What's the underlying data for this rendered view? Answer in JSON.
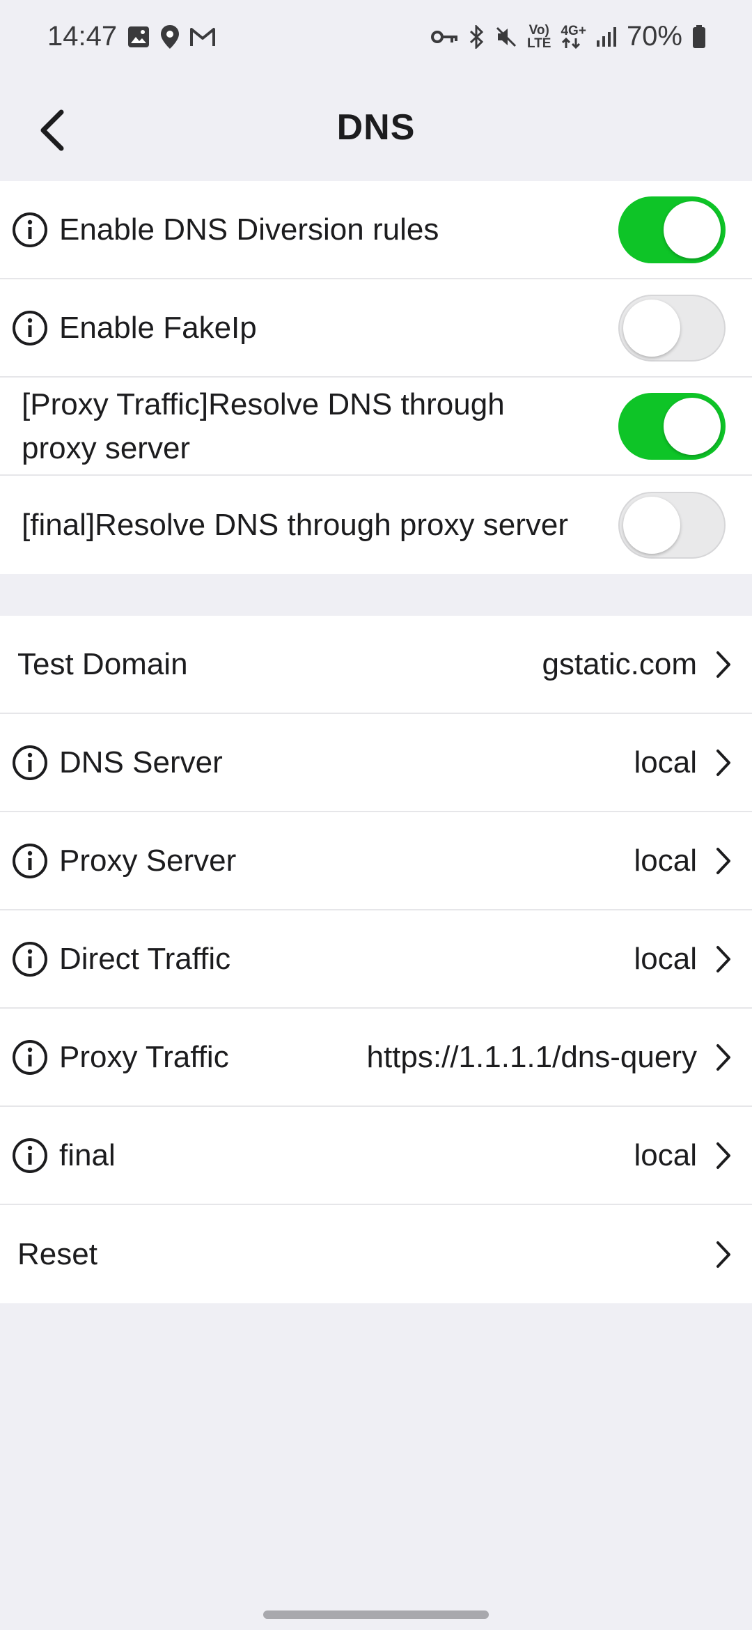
{
  "status_bar": {
    "time": "14:47",
    "left_icons": [
      "image-icon",
      "location-icon",
      "gmail-icon"
    ],
    "right_icons": [
      "vpn-key-icon",
      "bluetooth-icon",
      "mute-icon",
      "volte-icon",
      "4g-data-icon",
      "signal-icon"
    ],
    "volte_line1": "Vo)",
    "volte_line2": "LTE",
    "net_label": "4G+",
    "battery": "70%"
  },
  "header": {
    "title": "DNS",
    "back_icon": "chevron-left-icon"
  },
  "colors": {
    "toggle_on": "#0ec427",
    "toggle_off": "#e9e9ea",
    "background": "#efeff4"
  },
  "toggles": [
    {
      "label": "Enable DNS Diversion rules",
      "info_icon": true,
      "on": true
    },
    {
      "label": "Enable FakeIp",
      "info_icon": true,
      "on": false
    },
    {
      "label": "[Proxy Traffic]Resolve DNS through proxy server",
      "info_icon": false,
      "on": true
    },
    {
      "label": "[final]Resolve DNS through proxy server",
      "info_icon": false,
      "on": false
    }
  ],
  "settings": [
    {
      "label": "Test Domain",
      "value": "gstatic.com",
      "info_icon": false
    },
    {
      "label": "DNS Server",
      "value": "local",
      "info_icon": true
    },
    {
      "label": "Proxy Server",
      "value": "local",
      "info_icon": true
    },
    {
      "label": "Direct Traffic",
      "value": "local",
      "info_icon": true
    },
    {
      "label": "Proxy Traffic",
      "value": "https://1.1.1.1/dns-query",
      "info_icon": true
    },
    {
      "label": "final",
      "value": "local",
      "info_icon": true
    },
    {
      "label": "Reset",
      "value": "",
      "info_icon": false
    }
  ]
}
